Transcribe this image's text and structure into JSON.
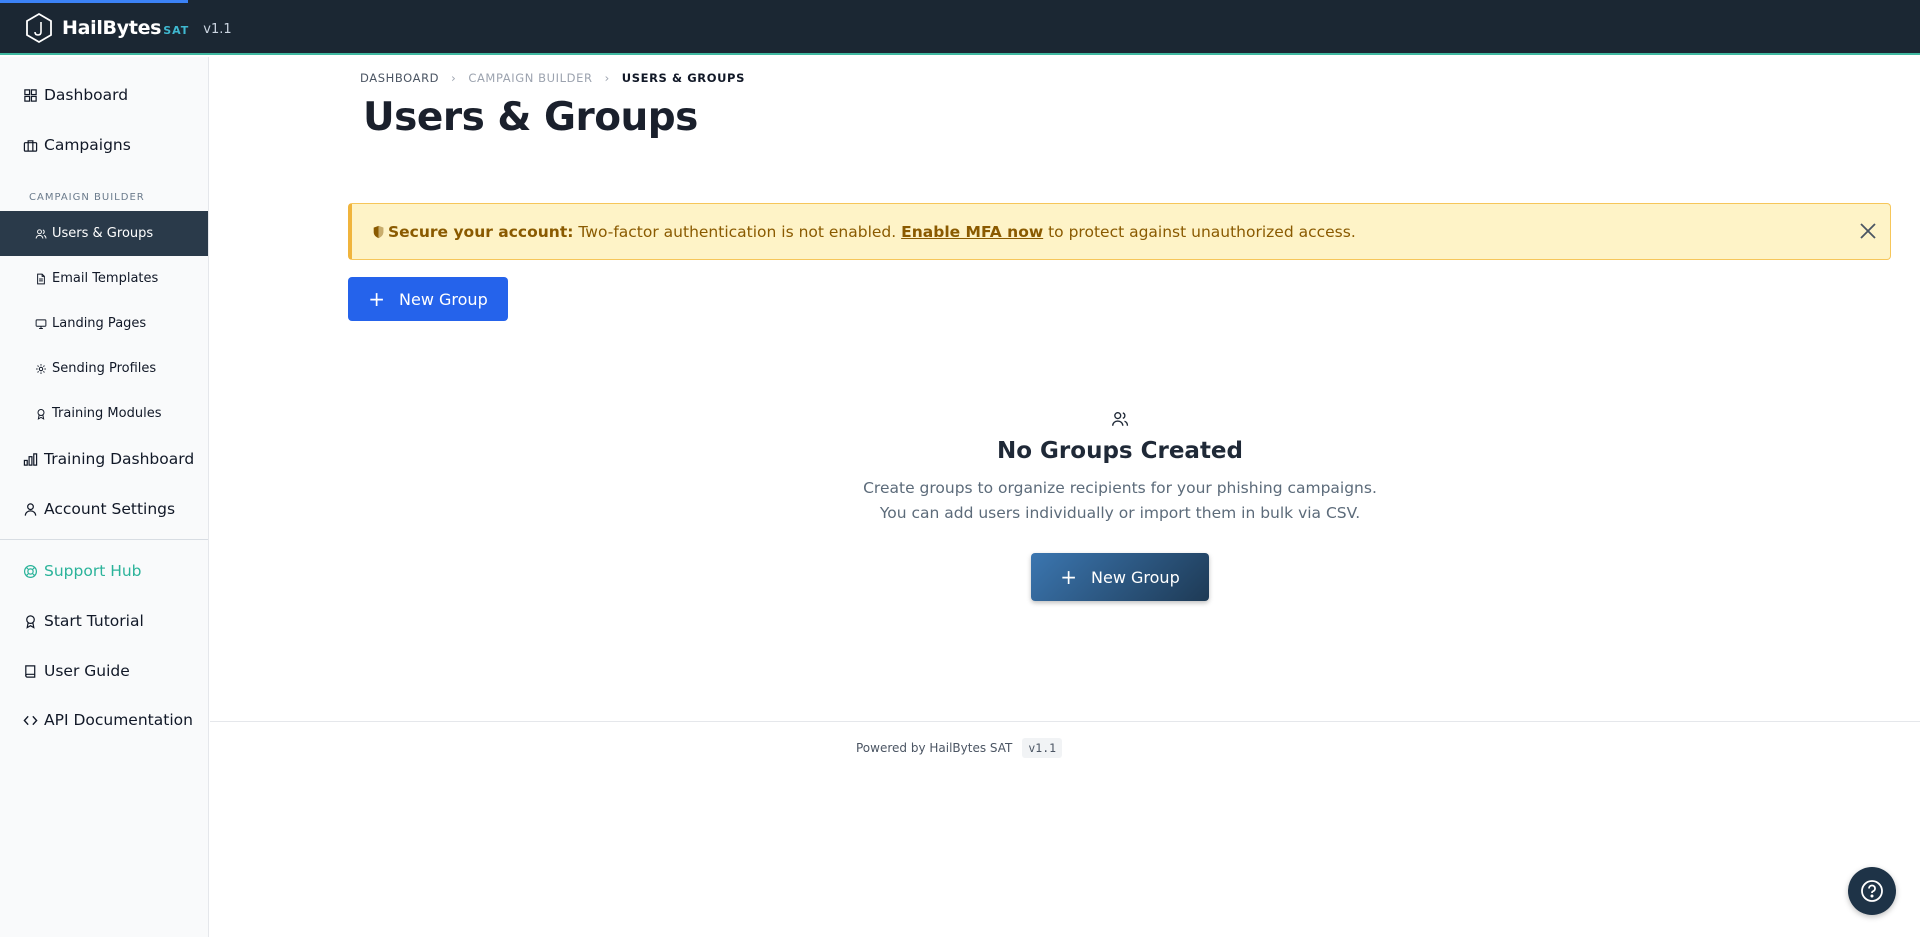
{
  "app": {
    "name": "HailBytes",
    "suffix": "SAT",
    "version": "v1.1"
  },
  "colors": {
    "topbar": "#1b2733",
    "accent": "#3fb8a0",
    "primary": "#2563eb",
    "alert_bg": "#fef3c7",
    "alert_text": "#8a5a00",
    "active_nav": "#2a3a4a"
  },
  "sidebar": {
    "items": [
      {
        "label": "Dashboard",
        "icon": "grid-icon"
      },
      {
        "label": "Campaigns",
        "icon": "briefcase-icon"
      }
    ],
    "section_label": "CAMPAIGN BUILDER",
    "sub_items": [
      {
        "label": "Users & Groups",
        "icon": "users-icon",
        "active": true
      },
      {
        "label": "Email Templates",
        "icon": "document-icon"
      },
      {
        "label": "Landing Pages",
        "icon": "monitor-icon"
      },
      {
        "label": "Sending Profiles",
        "icon": "gear-icon"
      },
      {
        "label": "Training Modules",
        "icon": "award-icon"
      }
    ],
    "items_after": [
      {
        "label": "Training Dashboard",
        "icon": "bar-chart-icon"
      },
      {
        "label": "Account Settings",
        "icon": "user-icon"
      }
    ],
    "support": [
      {
        "label": "Support Hub",
        "icon": "lifebuoy-icon"
      },
      {
        "label": "Start Tutorial",
        "icon": "award-icon"
      },
      {
        "label": "User Guide",
        "icon": "book-icon"
      },
      {
        "label": "API Documentation",
        "icon": "code-icon"
      }
    ]
  },
  "breadcrumb": [
    "DASHBOARD",
    "CAMPAIGN BUILDER",
    "USERS & GROUPS"
  ],
  "breadcrumb_sep": "›",
  "page_title": "Users & Groups",
  "alert": {
    "bold": "Secure your account:",
    "text": "Two-factor authentication is not enabled.",
    "link": "Enable MFA now",
    "text_after": "to protect against unauthorized access."
  },
  "new_group_label": "New Group",
  "plus_glyph": "+",
  "empty_state": {
    "title": "No Groups Created",
    "line1": "Create groups to organize recipients for your phishing campaigns.",
    "line2": "You can add users individually or import them in bulk via CSV.",
    "button": "New Group"
  },
  "footer": {
    "text": "Powered by HailBytes SAT",
    "version": "v1.1"
  }
}
